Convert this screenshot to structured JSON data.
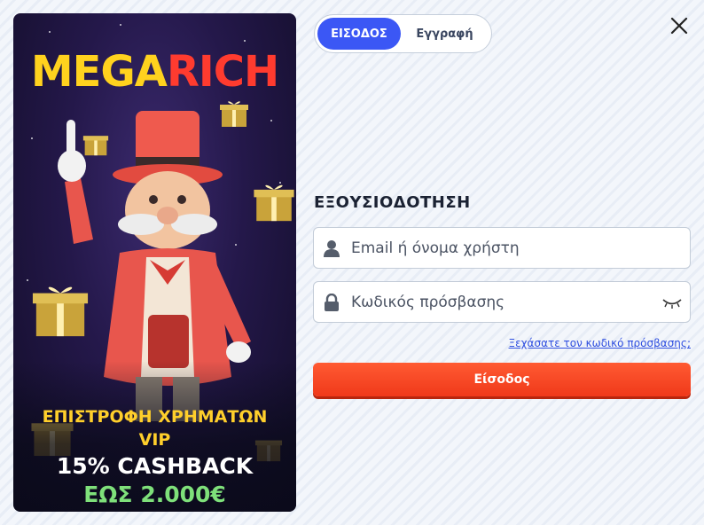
{
  "promo": {
    "logo_part1": "MEGA",
    "logo_part2": "RICH",
    "line1": "ΕΠΙΣΤΡΟΦΗ ΧΡΗΜΑΤΩΝ",
    "line2": "VIP",
    "line3": "15% CASHBACK",
    "line4": "ΕΩΣ 2.000€"
  },
  "tabs": {
    "login_label": "ΕΙΣΟΔΟΣ",
    "register_label": "Εγγραφή"
  },
  "auth": {
    "title": "ΕΞΟΥΣΙΟΔΟΤΗΣΗ",
    "email_placeholder": "Email ή όνομα χρήστη",
    "password_placeholder": "Κωδικός πρόσβασης",
    "forgot_link": "Ξεχάσατε τον κωδικό πρόσβασης;",
    "submit_label": "Είσοδος"
  },
  "icons": {
    "close": "close-icon",
    "user": "user-icon",
    "lock": "lock-icon",
    "eye": "eye-closed-icon"
  },
  "colors": {
    "accent_blue": "#3b57f5",
    "submit_orange": "#f0391a",
    "link_blue": "#2f4fe0",
    "logo_yellow": "#ffd21e",
    "logo_red": "#ff3b2f",
    "cashback_green": "#7ee07a"
  }
}
